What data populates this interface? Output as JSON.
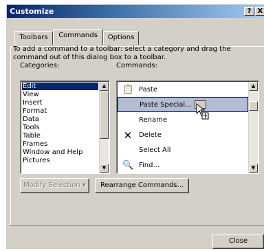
{
  "window": {
    "title": "Customize",
    "help_label": "?",
    "close_label": "X"
  },
  "tabs": [
    {
      "label": "Toolbars",
      "active": false
    },
    {
      "label": "Commands",
      "active": true
    },
    {
      "label": "Options",
      "active": false
    }
  ],
  "description": "To add a command to a toolbar: select a category and drag the command out of this dialog box to a toolbar.",
  "categories": {
    "label": "Categories:",
    "items": [
      "Edit",
      "View",
      "Insert",
      "Format",
      "Data",
      "Tools",
      "Table",
      "Frames",
      "Window and Help",
      "Pictures"
    ],
    "selected_index": 0
  },
  "commands": {
    "label": "Commands:",
    "items": [
      {
        "label": "Paste",
        "icon": "paste-icon"
      },
      {
        "label": "Paste Special...",
        "icon": "paste-special-icon"
      },
      {
        "label": "Rename",
        "icon": "rename-icon"
      },
      {
        "label": "Delete",
        "icon": "delete-icon"
      },
      {
        "label": "Select All",
        "icon": "select-all-icon"
      },
      {
        "label": "Find...",
        "icon": "find-icon"
      }
    ],
    "selected_index": 1
  },
  "buttons": {
    "modify_selection": "Modify Selection ▾",
    "rearrange_commands": "Rearrange Commands...",
    "close": "Close"
  },
  "colors": {
    "title_gradient_start": "#0a246a",
    "selection": "#0a246a",
    "dialog_face": "#d4d0c8"
  }
}
